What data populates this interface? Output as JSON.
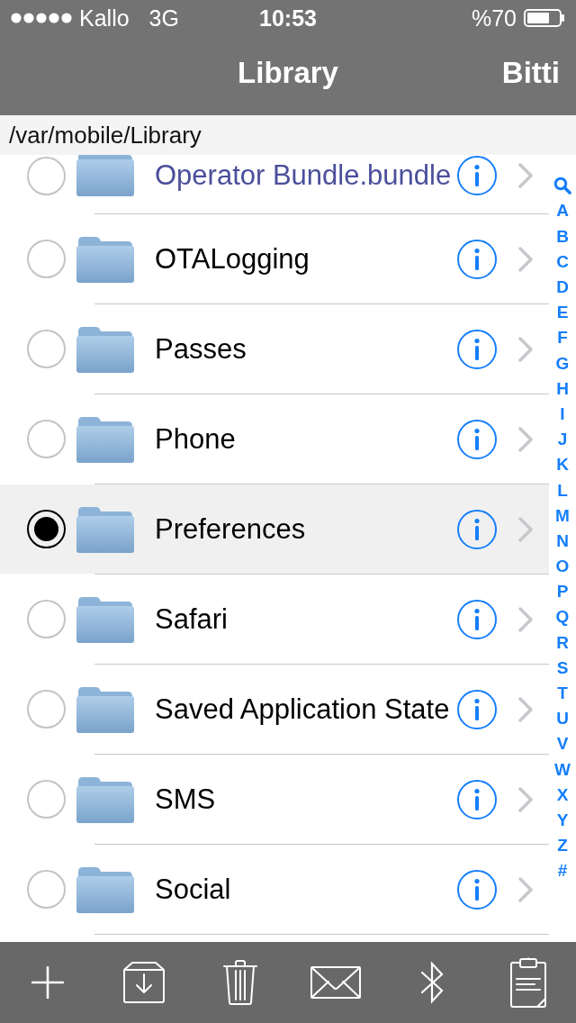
{
  "status_bar": {
    "carrier": "Kallo",
    "network": "3G",
    "time": "10:53",
    "battery": "%70"
  },
  "nav_bar": {
    "title": "Library",
    "done_button": "Bitti"
  },
  "path": "/var/mobile/Library",
  "files": [
    {
      "name": "Operator Bundle.bundle",
      "color": "#4b4f9b",
      "selected": false
    },
    {
      "name": "OTALogging",
      "color": "#000000",
      "selected": false
    },
    {
      "name": "Passes",
      "color": "#000000",
      "selected": false
    },
    {
      "name": "Phone",
      "color": "#000000",
      "selected": false
    },
    {
      "name": "Preferences",
      "color": "#000000",
      "selected": true
    },
    {
      "name": "Safari",
      "color": "#000000",
      "selected": false
    },
    {
      "name": "Saved Application State",
      "color": "#000000",
      "selected": false
    },
    {
      "name": "SMS",
      "color": "#000000",
      "selected": false
    },
    {
      "name": "Social",
      "color": "#000000",
      "selected": false
    }
  ],
  "section_index": [
    "A",
    "B",
    "C",
    "D",
    "E",
    "F",
    "G",
    "H",
    "I",
    "J",
    "K",
    "L",
    "M",
    "N",
    "O",
    "P",
    "Q",
    "R",
    "S",
    "T",
    "U",
    "V",
    "W",
    "X",
    "Y",
    "Z",
    "#"
  ]
}
